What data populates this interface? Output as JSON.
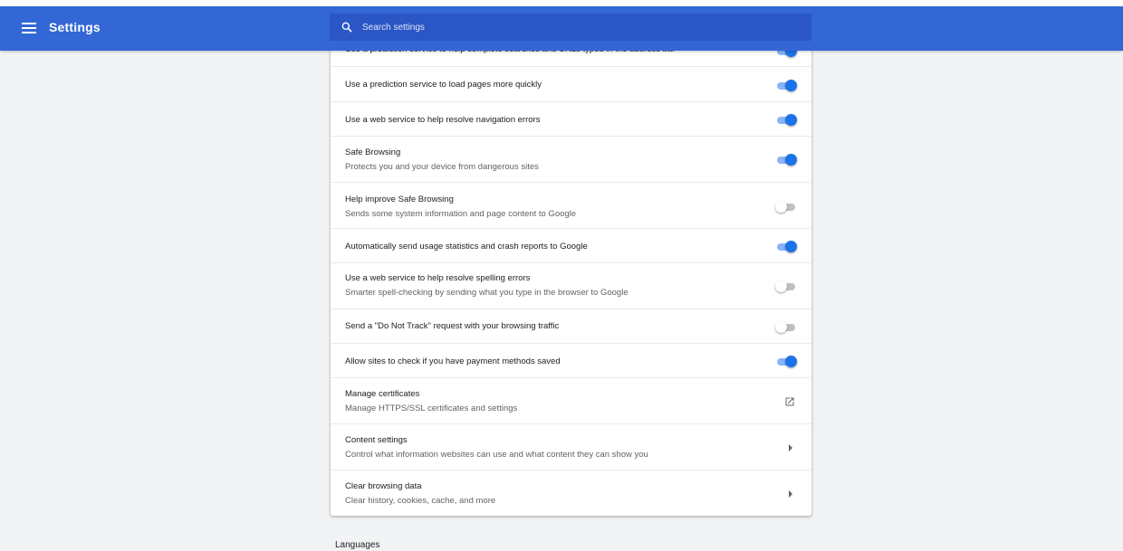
{
  "toolbar": {
    "title": "Settings",
    "search_placeholder": "Search settings"
  },
  "rows": [
    {
      "title": "Use a prediction service to help complete searches and URLs typed in the address bar",
      "control": "toggle",
      "on": true
    },
    {
      "title": "Use a prediction service to load pages more quickly",
      "control": "toggle",
      "on": true
    },
    {
      "title": "Use a web service to help resolve navigation errors",
      "control": "toggle",
      "on": true
    },
    {
      "title": "Safe Browsing",
      "subtitle": "Protects you and your device from dangerous sites",
      "control": "toggle",
      "on": true
    },
    {
      "title": "Help improve Safe Browsing",
      "subtitle": "Sends some system information and page content to Google",
      "control": "toggle",
      "on": false
    },
    {
      "title": "Automatically send usage statistics and crash reports to Google",
      "control": "toggle",
      "on": true
    },
    {
      "title": "Use a web service to help resolve spelling errors",
      "subtitle": "Smarter spell-checking by sending what you type in the browser to Google",
      "control": "toggle",
      "on": false
    },
    {
      "title": "Send a \"Do Not Track\" request with your browsing traffic",
      "control": "toggle",
      "on": false
    },
    {
      "title": "Allow sites to check if you have payment methods saved",
      "control": "toggle",
      "on": true
    },
    {
      "title": "Manage certificates",
      "subtitle": "Manage HTTPS/SSL certificates and settings",
      "control": "external"
    },
    {
      "title": "Content settings",
      "subtitle": "Control what information websites can use and what content they can show you",
      "control": "arrow"
    },
    {
      "title": "Clear browsing data",
      "subtitle": "Clear history, cookies, cache, and more",
      "control": "arrow"
    }
  ],
  "next_section": "Languages",
  "colors": {
    "toolbar": "#3367d6",
    "search_box": "#2a56c6",
    "toggle_on": "#1a73e8",
    "background": "#f1f3f4"
  }
}
